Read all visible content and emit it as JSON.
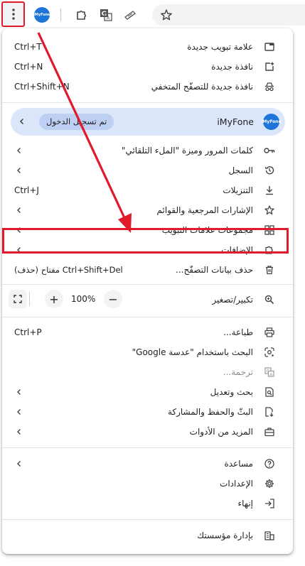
{
  "toolbar": {
    "menu_icon": "more-vert-icon",
    "profile_badge": "iMyFone",
    "extensions_icon": "extensions-icon",
    "translate_icon": "translate-icon",
    "reader_icon": "reader-icon",
    "bookmark_icon": "star-icon"
  },
  "menu": {
    "group1": [
      {
        "label": "علامة تبويب جديدة",
        "shortcut": "Ctrl+T",
        "icon": "new-tab-icon"
      },
      {
        "label": "نافذة جديدة",
        "shortcut": "Ctrl+N",
        "icon": "new-window-icon"
      },
      {
        "label": "نافذة جديدة للتصفّح المتخفي",
        "shortcut": "Ctrl+Shift+N",
        "icon": "incognito-icon"
      }
    ],
    "profile": {
      "name": "iMyFone",
      "chip": "تم تسجيل الدخول",
      "avatar_text": "iMyFone"
    },
    "group2": [
      {
        "label": "كلمات المرور وميزة \"الملء التلقائي\"",
        "icon": "key-icon"
      },
      {
        "label": "السجل",
        "icon": "history-icon"
      },
      {
        "label": "التنزيلات",
        "shortcut": "Ctrl+J",
        "icon": "download-icon"
      },
      {
        "label": "الإشارات المرجعية والقوائم",
        "icon": "star-icon"
      },
      {
        "label": "مجموعات علامات التبويب",
        "icon": "tab-groups-icon"
      },
      {
        "label": "الإضافات",
        "icon": "extension-icon"
      },
      {
        "label": "حذف بيانات التصفّح...",
        "shortcut": "Ctrl+Shift+Del مفتاح (حذف)",
        "icon": "trash-icon"
      }
    ],
    "zoom": {
      "label": "تكبير/تصغير",
      "value": "100%",
      "minus": "−",
      "plus": "+",
      "icon": "zoom-icon",
      "fullscreen_icon": "fullscreen-icon"
    },
    "group3": [
      {
        "label": "طباعة...",
        "shortcut": "Ctrl+P",
        "icon": "print-icon"
      },
      {
        "label": "البحث باستخدام \"عدسة Google\"",
        "icon": "lens-icon"
      },
      {
        "label": "ترجمة...",
        "icon": "translate-icon",
        "disabled": true
      },
      {
        "label": "بحث وتعديل",
        "icon": "find-icon"
      },
      {
        "label": "البثّ والحفظ والمشاركة",
        "icon": "cast-save-icon"
      },
      {
        "label": "المزيد من الأدوات",
        "icon": "toolbox-icon"
      }
    ],
    "group4": [
      {
        "label": "مساعدة",
        "icon": "help-icon"
      },
      {
        "label": "الإعدادات",
        "icon": "settings-icon"
      },
      {
        "label": "إنهاء",
        "icon": "exit-icon"
      }
    ],
    "group5": [
      {
        "label": "بإدارة مؤسستك",
        "icon": "business-icon"
      }
    ]
  },
  "colors": {
    "highlight": "#e0192b",
    "profile_bg": "#dbe6fb",
    "chip_bg": "#bdd0f3",
    "avatar": "#1d75d9"
  }
}
